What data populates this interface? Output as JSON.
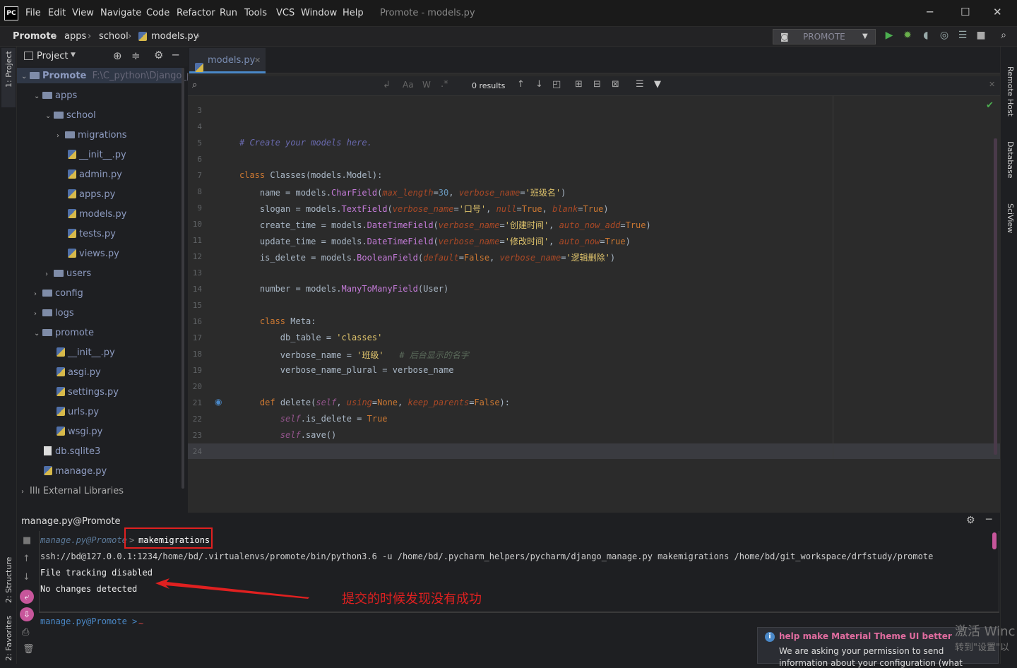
{
  "app": {
    "logo": "PC",
    "window_title": "Promote - models.py"
  },
  "menu": [
    "File",
    "Edit",
    "View",
    "Navigate",
    "Code",
    "Refactor",
    "Run",
    "Tools",
    "VCS",
    "Window",
    "Help"
  ],
  "breadcrumb": [
    "Promote",
    "apps",
    "school",
    "models.py"
  ],
  "run_config": "PROMOTE",
  "project_panel": {
    "title": "Project",
    "root": "Promote",
    "root_path": "F:\\C_python\\Django_pro",
    "items": [
      {
        "label": "apps",
        "kind": "folder",
        "arrow": "⌄"
      },
      {
        "label": "school",
        "kind": "folder",
        "arrow": "⌄"
      },
      {
        "label": "migrations",
        "kind": "folder",
        "arrow": "›"
      },
      {
        "label": "__init__.py",
        "kind": "py"
      },
      {
        "label": "admin.py",
        "kind": "py"
      },
      {
        "label": "apps.py",
        "kind": "py"
      },
      {
        "label": "models.py",
        "kind": "py"
      },
      {
        "label": "tests.py",
        "kind": "py"
      },
      {
        "label": "views.py",
        "kind": "py"
      },
      {
        "label": "users",
        "kind": "folder",
        "arrow": "›"
      },
      {
        "label": "config",
        "kind": "folder",
        "arrow": "›"
      },
      {
        "label": "logs",
        "kind": "folder",
        "arrow": "›"
      },
      {
        "label": "promote",
        "kind": "folder",
        "arrow": "⌄"
      },
      {
        "label": "__init__.py",
        "kind": "py"
      },
      {
        "label": "asgi.py",
        "kind": "py"
      },
      {
        "label": "settings.py",
        "kind": "py"
      },
      {
        "label": "urls.py",
        "kind": "py"
      },
      {
        "label": "wsgi.py",
        "kind": "py"
      },
      {
        "label": "db.sqlite3",
        "kind": "file"
      },
      {
        "label": "manage.py",
        "kind": "py"
      },
      {
        "label": "External Libraries",
        "kind": "lib",
        "arrow": "›"
      }
    ]
  },
  "editor": {
    "tab": "models.py",
    "search_results": "0 results",
    "line_numbers": [
      "3",
      "4",
      "5",
      "6",
      "7",
      "8",
      "9",
      "10",
      "11",
      "12",
      "13",
      "14",
      "15",
      "16",
      "17",
      "18",
      "19",
      "20",
      "21",
      "22",
      "23",
      "24"
    ]
  },
  "code": {
    "comment_models": "# Create your models here.",
    "class_name": "Classes",
    "name_label": "'班级名'",
    "slogan_label": "'口号'",
    "create_label": "'创建时间'",
    "update_label": "'修改时间'",
    "delete_label": "'逻辑删除'",
    "db_table": "'classes'",
    "verbose": "'班级'",
    "verbose_comment": "# 后台显示的名字"
  },
  "right_tools": [
    "Remote Host",
    "Database",
    "SciView"
  ],
  "left_tools": [
    "1: Project",
    "2: Structure",
    "2: Favorites"
  ],
  "terminal": {
    "title": "manage.py@Promote",
    "prompt": "manage.py@Promote",
    "command": "makemigrations",
    "ssh_line": "ssh://bd@127.0.0.1:1234/home/bd/.virtualenvs/promote/bin/python3.6 -u /home/bd/.pycharm_helpers/pycharm/django_manage.py makemigrations /home/bd/git_workspace/drfstudy/promote",
    "line2": "File tracking disabled",
    "line3": "No changes detected",
    "prompt2": "manage.py@Promote > ",
    "annotation": "提交的时候发现没有成功"
  },
  "notification": {
    "title": "help make Material Theme UI better",
    "body": "We are asking your permission to send",
    "body2": "information about your configuration (what"
  },
  "watermark": {
    "line1": "激活 Winc",
    "line2": "转到\"设置\"以"
  }
}
